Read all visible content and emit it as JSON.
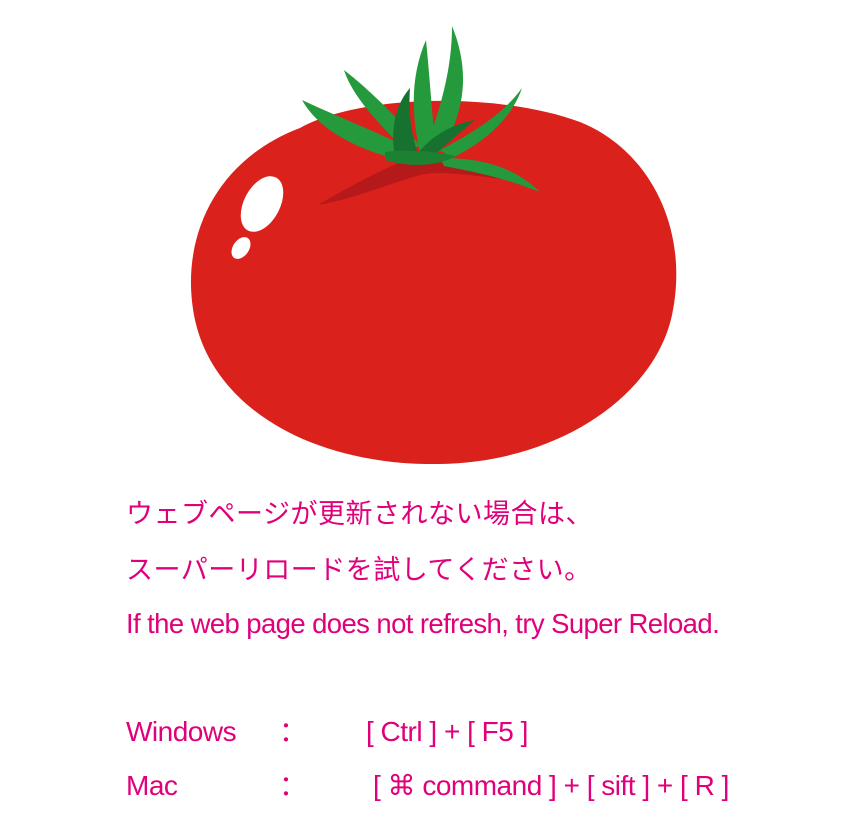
{
  "colors": {
    "text": "#e0007a",
    "tomato_body": "#db211c",
    "tomato_shadow": "#b01a18",
    "leaf_light": "#249a3c",
    "leaf_dark": "#16722e",
    "highlight": "#ffffff"
  },
  "illustration": {
    "icon": "tomato-icon"
  },
  "message": {
    "line1": "ウェブページが更新されない場合は、",
    "line2": "スーパーリロードを試してください。",
    "line3": "If the web page does not refresh, try Super Reload."
  },
  "shortcuts": [
    {
      "os": "Windows",
      "colon": "：",
      "keys": "[ Ctrl ] + [ F5 ]"
    },
    {
      "os": "Mac",
      "colon": "：",
      "keys": "[ ⌘ command ] + [ sift ] + [ R ]"
    }
  ]
}
